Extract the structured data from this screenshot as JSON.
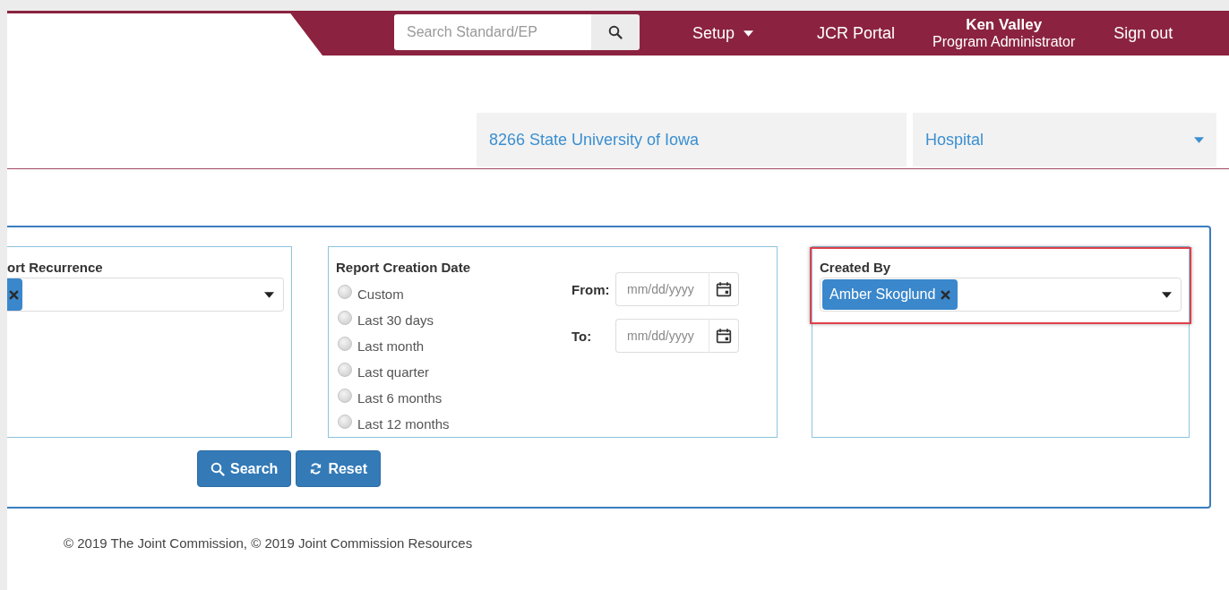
{
  "header": {
    "search": {
      "placeholder": "Search Standard/EP"
    },
    "menu": [
      {
        "label": "Setup",
        "kind": "dropdown"
      },
      {
        "label": "JCR Portal",
        "kind": "link"
      }
    ],
    "user": {
      "name": "Ken Valley",
      "role": "Program Administrator"
    },
    "sign_out": "Sign out"
  },
  "context": {
    "organization": "8266 State University of Iowa",
    "program": "Hospital"
  },
  "filters": {
    "recurrence": {
      "label": "ort Recurrence",
      "has_chip": true
    },
    "date": {
      "label": "Report Creation Date",
      "options": [
        {
          "label": "Custom",
          "selected": false
        },
        {
          "label": "Last 30 days",
          "selected": false
        },
        {
          "label": "Last month",
          "selected": false
        },
        {
          "label": "Last quarter",
          "selected": false
        },
        {
          "label": "Last 6 months",
          "selected": false
        },
        {
          "label": "Last 12 months",
          "selected": false
        }
      ],
      "from": {
        "label": "From:",
        "placeholder": "mm/dd/yyyy"
      },
      "to": {
        "label": "To:",
        "placeholder": "mm/dd/yyyy"
      }
    },
    "created_by": {
      "label": "Created By",
      "highlighted": true,
      "chips": [
        {
          "label": "Amber Skoglund"
        }
      ]
    },
    "buttons": [
      {
        "label": "Search",
        "kind": "search"
      },
      {
        "label": "Reset",
        "kind": "reset"
      }
    ]
  },
  "footer": "© 2019 The Joint Commission, © 2019 Joint Commission Resources"
}
